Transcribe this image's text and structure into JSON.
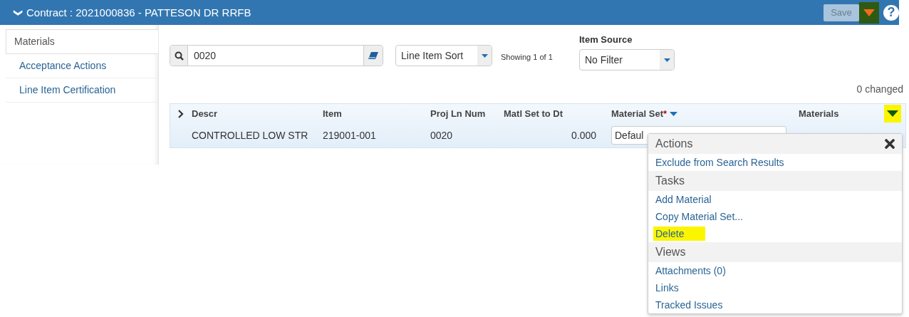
{
  "header": {
    "caret": "❯",
    "title": "Contract : 2021000836 - PATTESON DR RRFB",
    "save_button": {
      "label": "Save",
      "disabled": true
    },
    "menu_caret_highlighted": true,
    "help": "?"
  },
  "sidebar": {
    "items": [
      {
        "label": "Materials",
        "selected": true
      },
      {
        "label": "Acceptance Actions",
        "selected": false
      },
      {
        "label": "Line Item Certification",
        "selected": false
      }
    ]
  },
  "search": {
    "value": "0020"
  },
  "sort": {
    "value": "Line Item Sort"
  },
  "showing": "Showing 1 of 1",
  "item_source": {
    "label": "Item Source",
    "value": "No Filter"
  },
  "changed": "0 changed",
  "table": {
    "columns": [
      "Descr",
      "Item",
      "Proj Ln Num",
      "Matl Set to Dt",
      "Material Set",
      "Materials"
    ],
    "required_mark": "*",
    "menu_caret_highlighted": true,
    "rows": [
      {
        "cells": [
          "CONTROLLED LOW STR",
          "219001-001",
          "0020",
          "0.000",
          "Defaul"
        ]
      }
    ]
  },
  "context_menu": {
    "sections": [
      {
        "title": "Actions",
        "items": [
          {
            "label": "Exclude from Search Results",
            "highlighted": false
          }
        ]
      },
      {
        "title": "Tasks",
        "items": [
          {
            "label": "Add Material",
            "highlighted": false
          },
          {
            "label": "Copy Material Set...",
            "highlighted": false
          },
          {
            "label": "Delete",
            "highlighted": true
          }
        ]
      },
      {
        "title": "Views",
        "items": [
          {
            "label": "Attachments (0)",
            "highlighted": false
          },
          {
            "label": "Links",
            "highlighted": false
          },
          {
            "label": "Tracked Issues",
            "highlighted": false
          }
        ]
      }
    ]
  }
}
